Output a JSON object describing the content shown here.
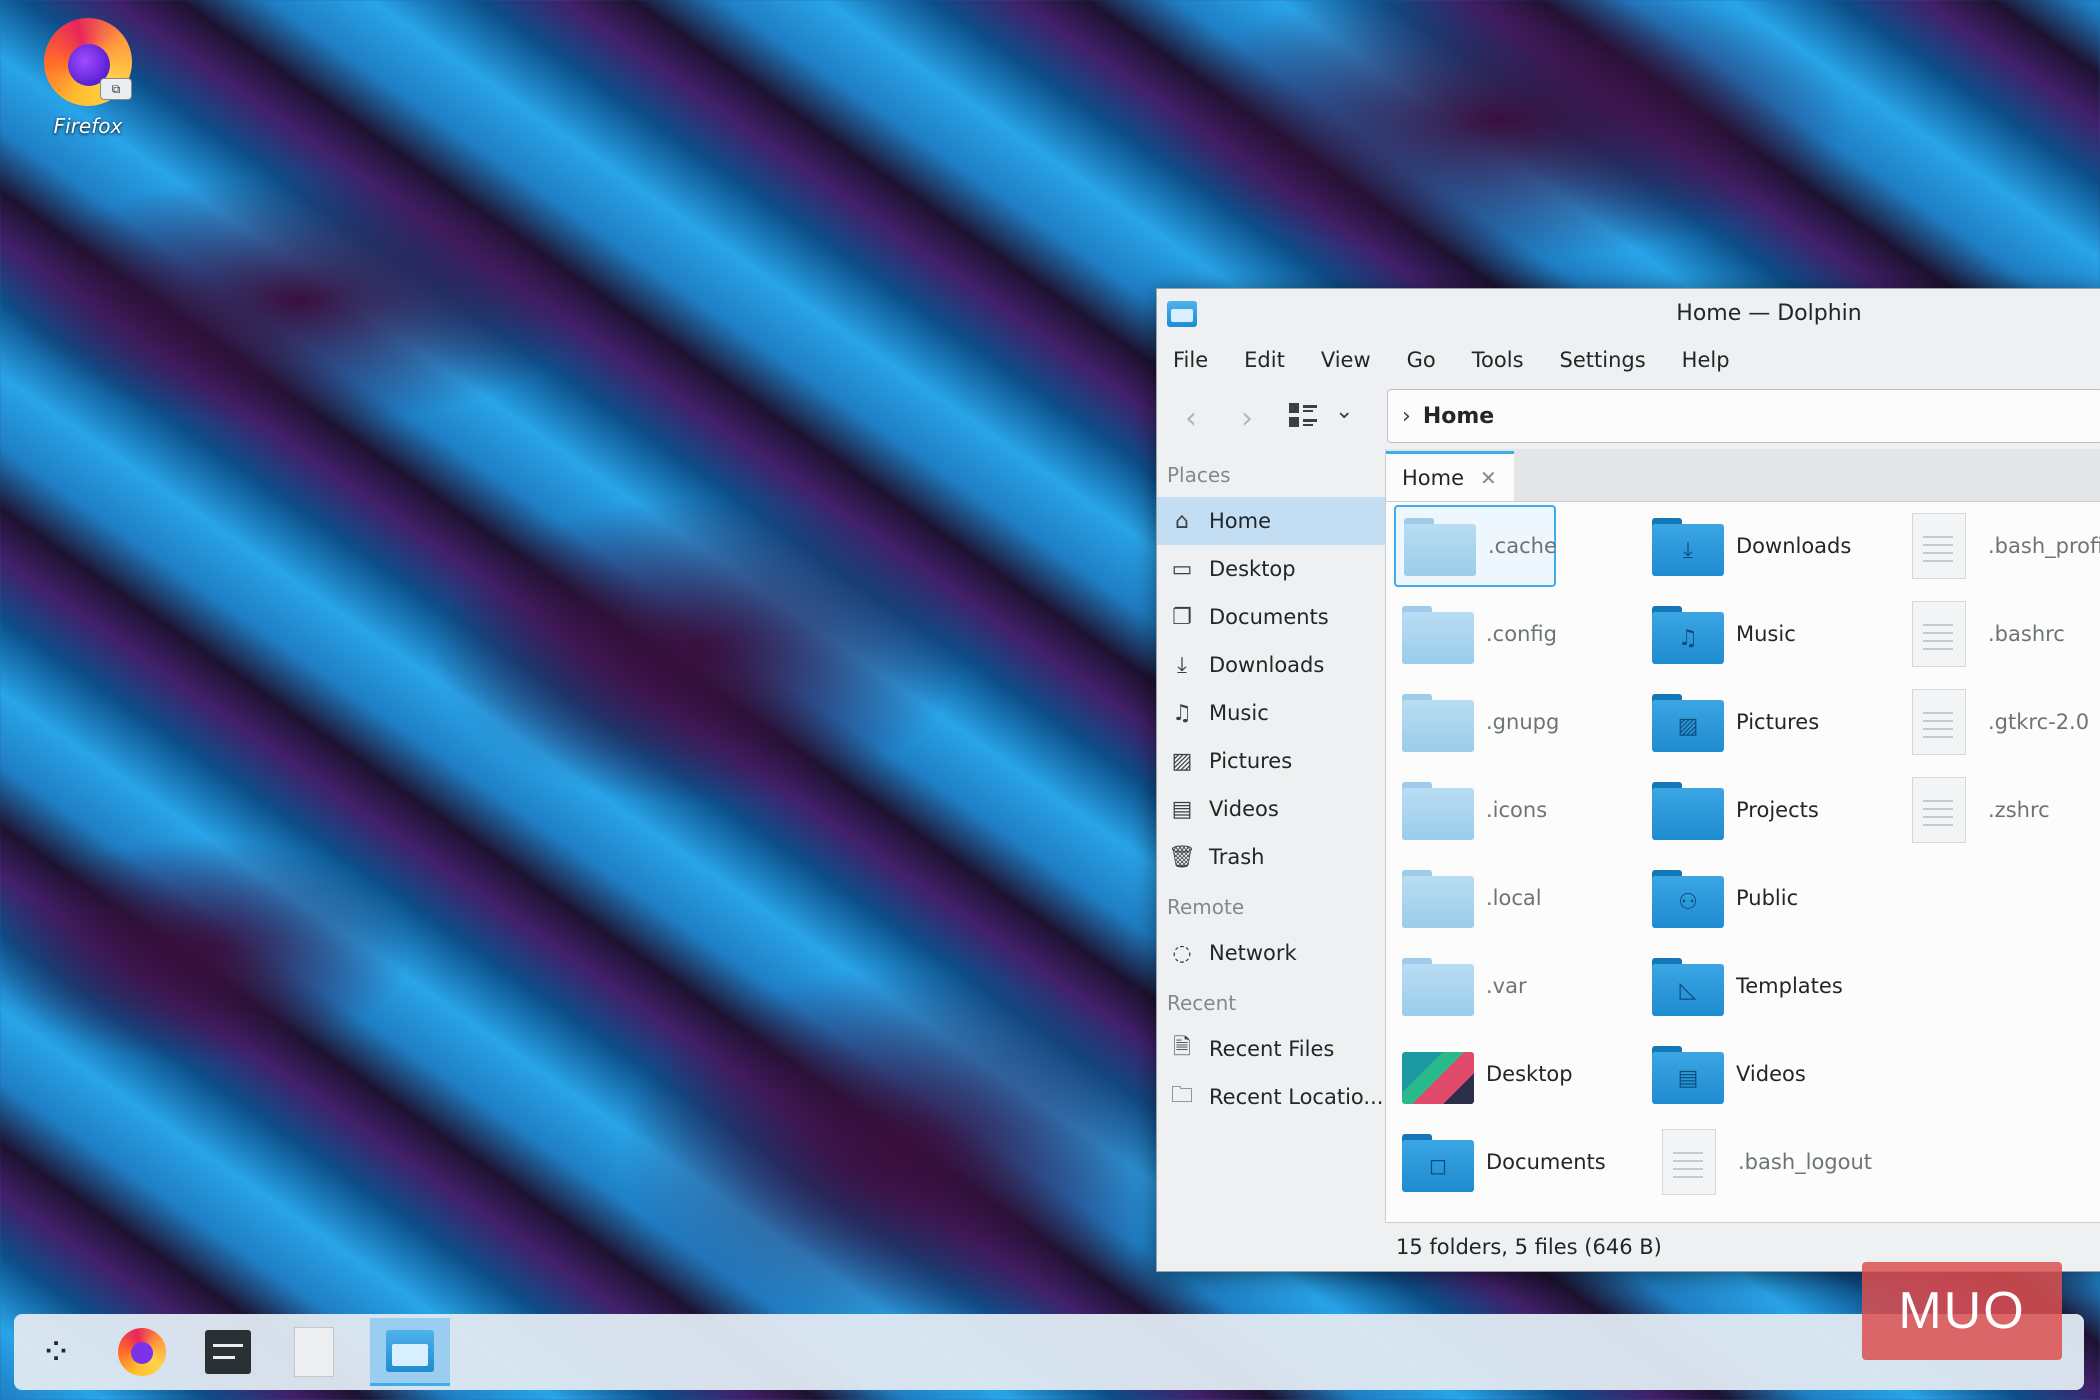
{
  "desktop": {
    "icon_label": "Firefox"
  },
  "window": {
    "title": "Home — Dolphin",
    "menu": [
      "File",
      "Edit",
      "View",
      "Go",
      "Tools",
      "Settings",
      "Help"
    ],
    "location": "Home"
  },
  "places": {
    "header_places": "Places",
    "items": [
      {
        "label": "Home",
        "icon": "home-icon"
      },
      {
        "label": "Desktop",
        "icon": "desktop-icon"
      },
      {
        "label": "Documents",
        "icon": "documents-icon"
      },
      {
        "label": "Downloads",
        "icon": "downloads-icon"
      },
      {
        "label": "Music",
        "icon": "music-icon"
      },
      {
        "label": "Pictures",
        "icon": "pictures-icon"
      },
      {
        "label": "Videos",
        "icon": "videos-icon"
      },
      {
        "label": "Trash",
        "icon": "trash-icon"
      }
    ],
    "header_remote": "Remote",
    "remote": [
      {
        "label": "Network",
        "icon": "network-icon"
      }
    ],
    "header_recent": "Recent",
    "recent": [
      {
        "label": "Recent Files",
        "icon": "recent-files-icon"
      },
      {
        "label": "Recent Locatio...",
        "icon": "recent-locations-icon"
      }
    ]
  },
  "tab": {
    "label": "Home",
    "close": "✕"
  },
  "files": {
    "col1": [
      ".cache",
      ".config",
      ".gnupg",
      ".icons",
      ".local",
      ".var",
      "Desktop",
      "Documents"
    ],
    "col2": [
      "Downloads",
      "Music",
      "Pictures",
      "Projects",
      "Public",
      "Templates",
      "Videos",
      ".bash_logout"
    ],
    "col3": [
      ".bash_profil",
      ".bashrc",
      ".gtkrc-2.0",
      ".zshrc"
    ]
  },
  "status": "15 folders, 5 files (646 B)",
  "watermark": "MUO",
  "colors": {
    "accent": "#3daee9",
    "selection": "#c3ddf3"
  }
}
